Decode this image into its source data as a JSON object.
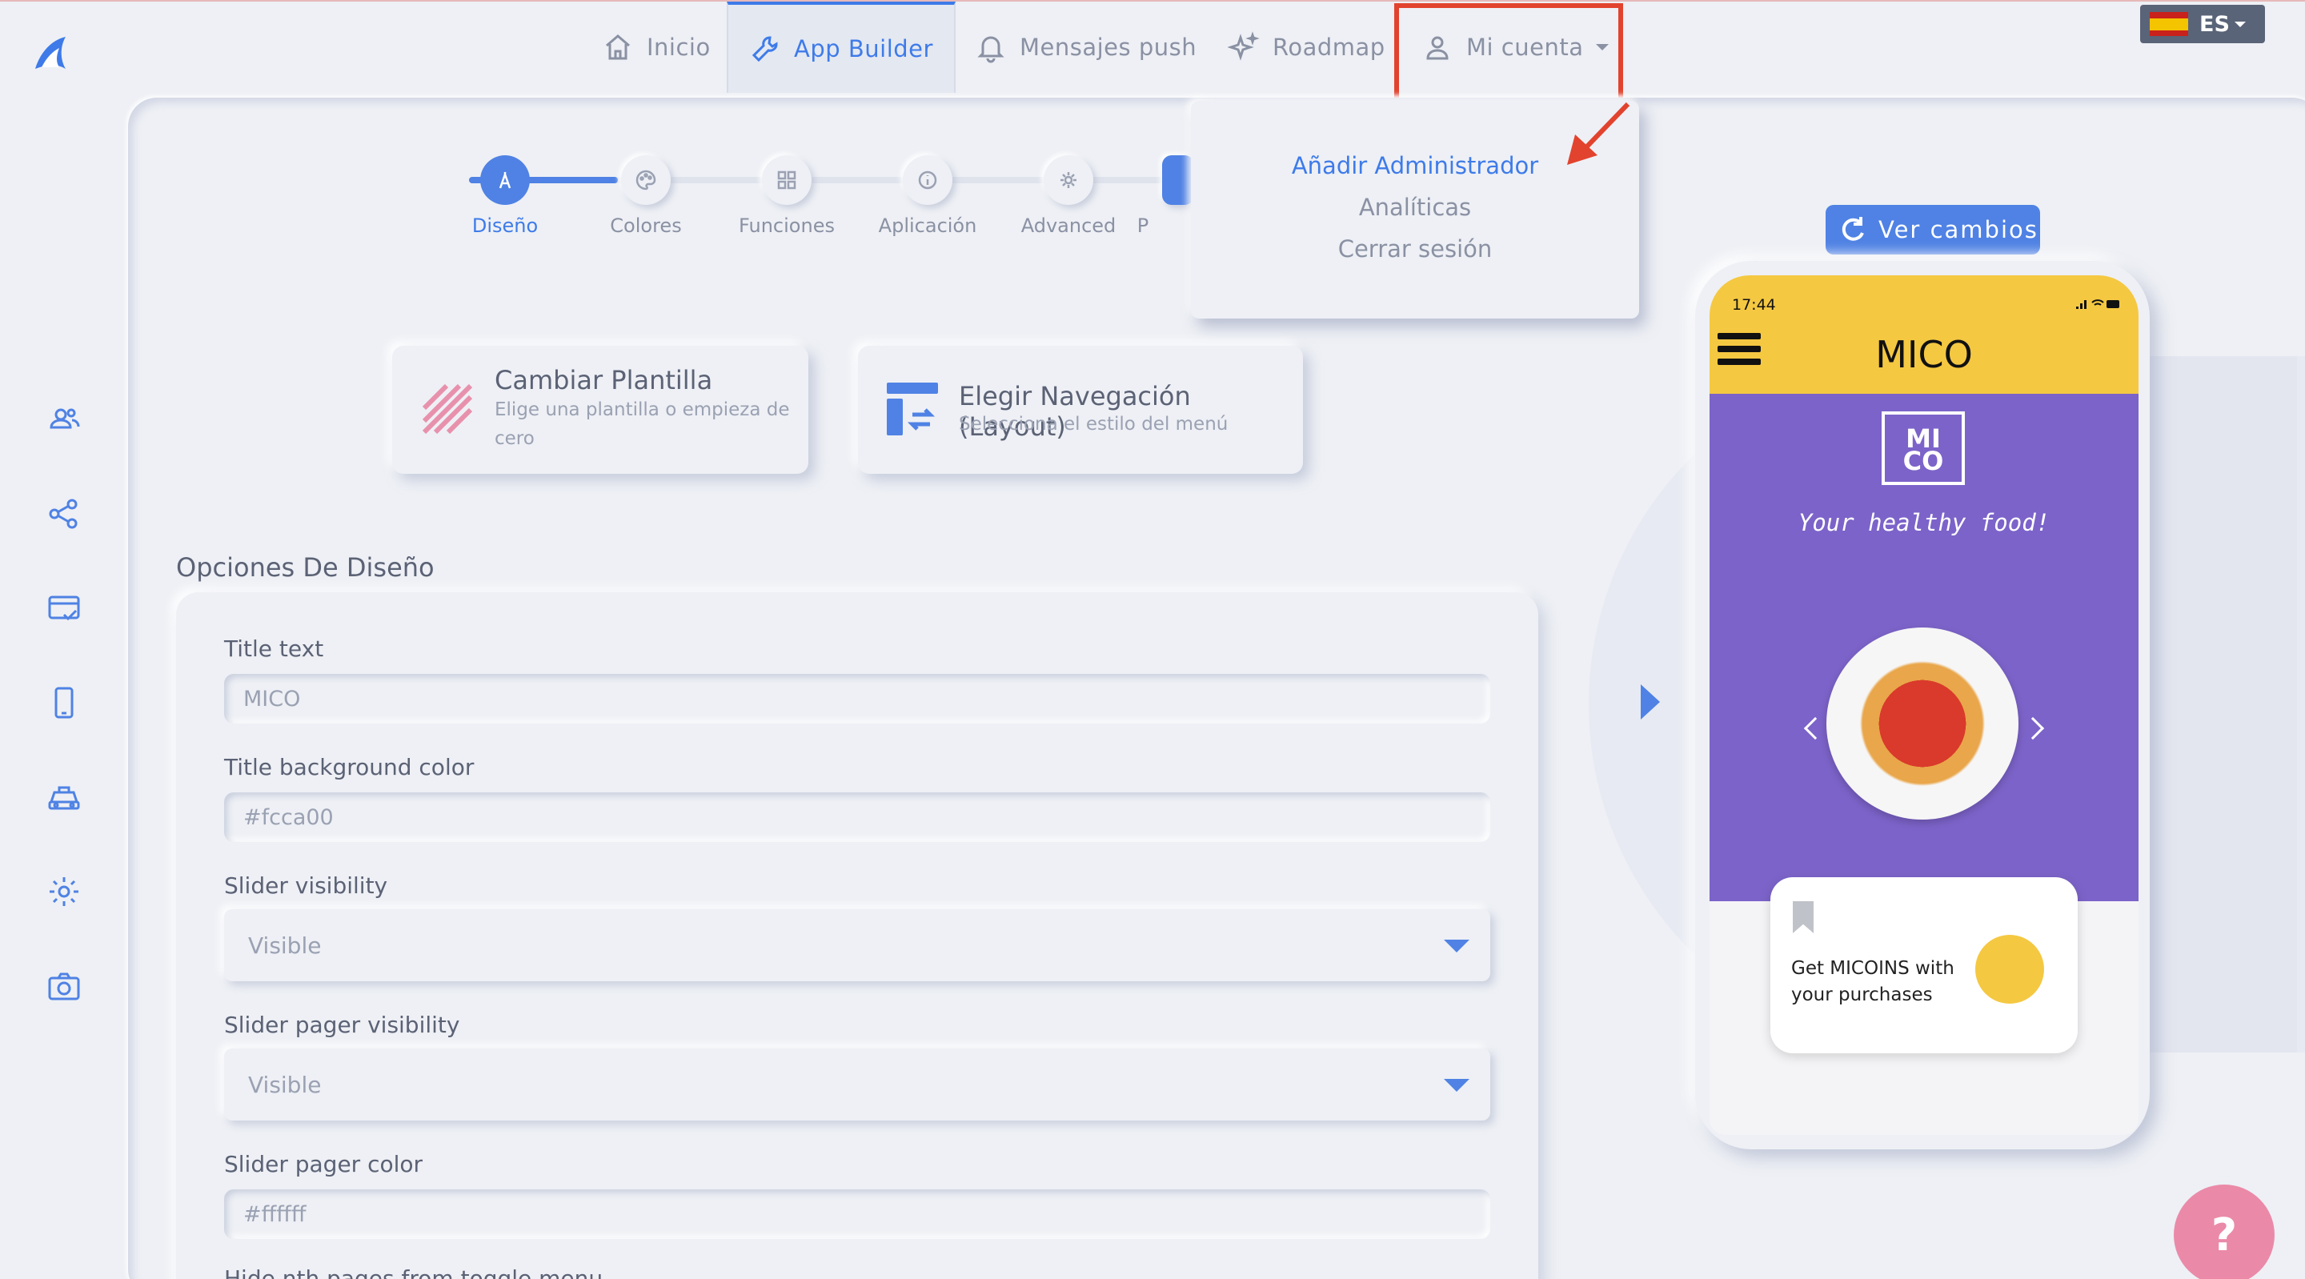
{
  "nav": {
    "items": [
      {
        "label": "Inicio",
        "icon": "home-icon"
      },
      {
        "label": "App Builder",
        "icon": "wrench-icon"
      },
      {
        "label": "Mensajes push",
        "icon": "bell-icon"
      },
      {
        "label": "Roadmap",
        "icon": "sparkle-icon"
      },
      {
        "label": "Mi cuenta",
        "icon": "user-icon"
      }
    ],
    "language": "ES"
  },
  "account_menu": {
    "items": [
      "Añadir Administrador",
      "Analíticas",
      "Cerrar sesión"
    ]
  },
  "stepper": {
    "steps": [
      "Diseño",
      "Colores",
      "Funciones",
      "Aplicación",
      "Advanced",
      "P"
    ]
  },
  "cards": {
    "template": {
      "title": "Cambiar Plantilla",
      "subtitle_line1": "Elige una plantilla o empieza de",
      "subtitle_line2": "cero"
    },
    "layout": {
      "title": "Elegir Navegación (Layout)",
      "subtitle": "Selecciona el estilo del menú"
    }
  },
  "design_options": {
    "section_title": "Opciones De Diseño",
    "title_text_label": "Title text",
    "title_text_value": "MICO",
    "title_bg_label": "Title background color",
    "title_bg_value": "#fcca00",
    "slider_visibility_label": "Slider visibility",
    "slider_visibility_value": "Visible",
    "slider_pager_visibility_label": "Slider pager visibility",
    "slider_pager_visibility_value": "Visible",
    "slider_pager_color_label": "Slider pager color",
    "slider_pager_color_value": "#ffffff",
    "next_label_partial": "Hide nth pages from toggle menu"
  },
  "preview": {
    "button_label": "Ver cambios",
    "time": "17:44",
    "app_title": "MICO",
    "logo_line1": "MI",
    "logo_line2": "CO",
    "tagline": "Your healthy food!",
    "card_text": "Get MICOINS with your purchases"
  },
  "help_label": "?",
  "colors": {
    "accent": "#3e7be9",
    "highlight_box": "#e2432e",
    "app_header": "#f5c842",
    "app_banner": "#7c63c9"
  }
}
